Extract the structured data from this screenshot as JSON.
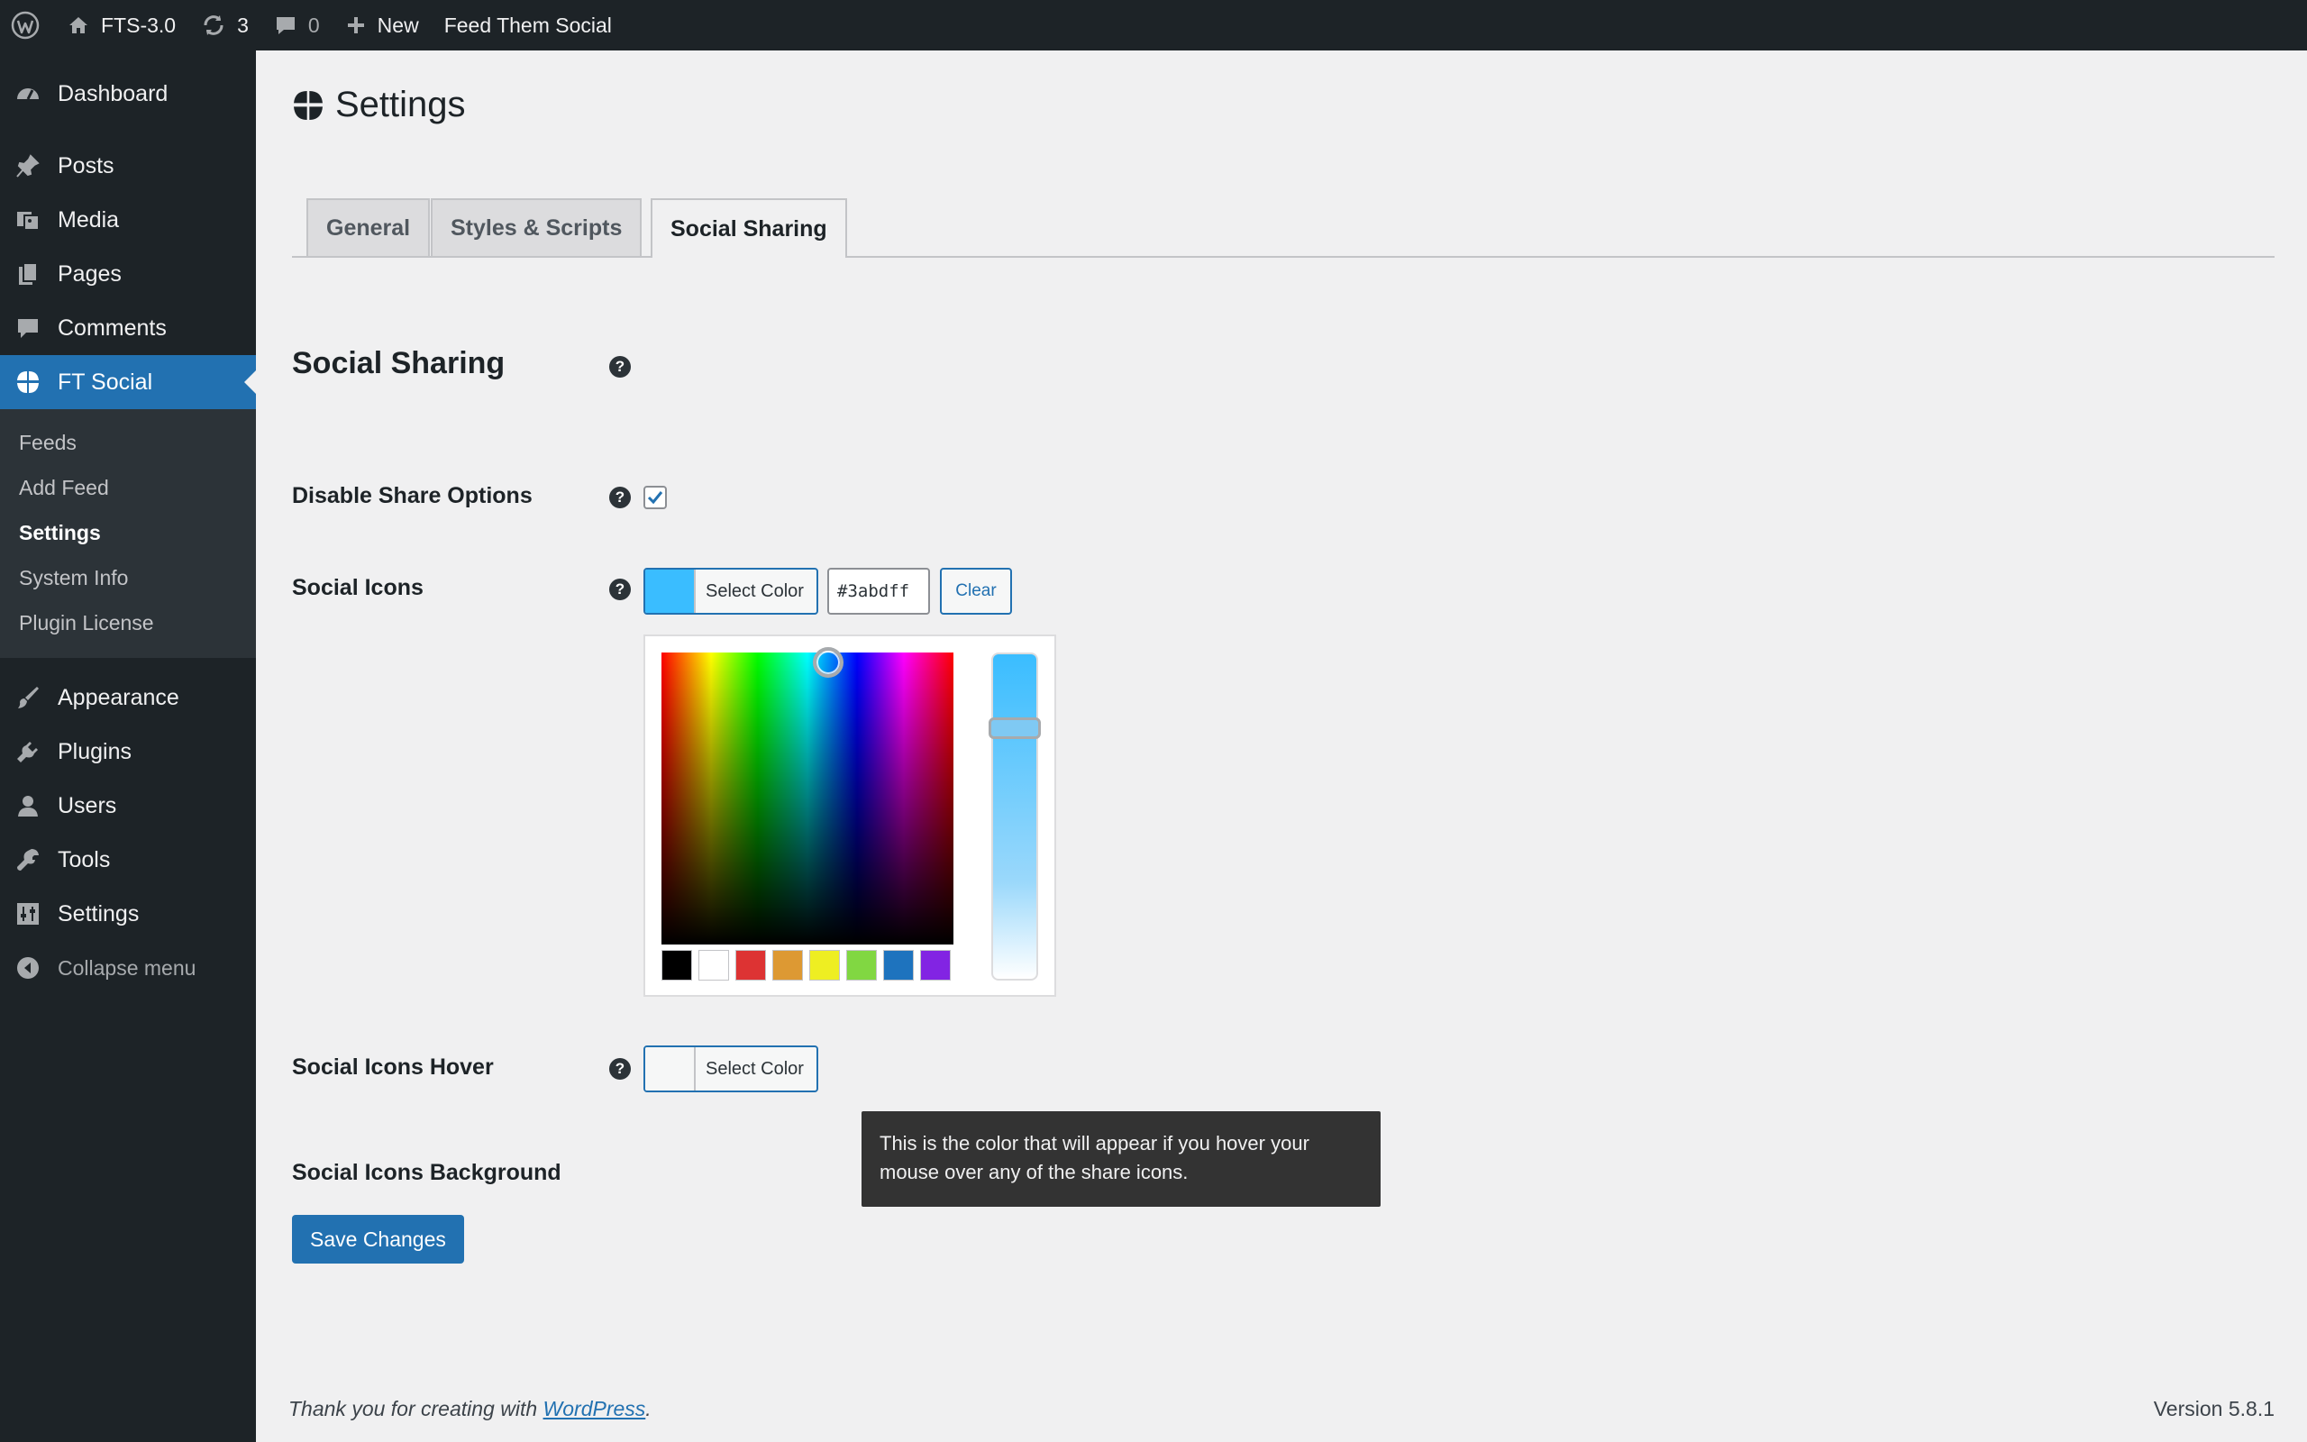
{
  "adminbar": {
    "site_name": "FTS-3.0",
    "updates_count": "3",
    "comments_count": "0",
    "new_label": "New",
    "plugin_label": "Feed Them Social"
  },
  "sidebar": {
    "items": [
      {
        "label": "Dashboard",
        "icon": "dashboard-icon"
      },
      {
        "label": "Posts",
        "icon": "pin-icon"
      },
      {
        "label": "Media",
        "icon": "media-icon"
      },
      {
        "label": "Pages",
        "icon": "pages-icon"
      },
      {
        "label": "Comments",
        "icon": "comment-icon"
      },
      {
        "label": "FT Social",
        "icon": "ft-social-icon"
      }
    ],
    "submenu": [
      "Feeds",
      "Add Feed",
      "Settings",
      "System Info",
      "Plugin License"
    ],
    "items_after": [
      {
        "label": "Appearance",
        "icon": "brush-icon"
      },
      {
        "label": "Plugins",
        "icon": "plugin-icon"
      },
      {
        "label": "Users",
        "icon": "user-icon"
      },
      {
        "label": "Tools",
        "icon": "wrench-icon"
      },
      {
        "label": "Settings",
        "icon": "settings-icon"
      }
    ],
    "collapse_label": "Collapse menu"
  },
  "page": {
    "title": "Settings",
    "tabs": [
      "General",
      "Styles & Scripts",
      "Social Sharing"
    ],
    "active_tab": "Social Sharing"
  },
  "form": {
    "section_title": "Social Sharing",
    "disable_share_label": "Disable Share Options",
    "social_icons_label": "Social Icons",
    "select_color_label": "Select Color",
    "color_value": "#3abdff",
    "clear_label": "Clear",
    "social_icons_hover_label": "Social Icons Hover",
    "hover_select_color_label": "Select Color",
    "social_icons_background_label": "Social Icons Background",
    "tooltip_text": "This is the color that will appear if you hover your mouse over any of the share icons.",
    "save_label": "Save Changes"
  },
  "palette": [
    "#000000",
    "#ffffff",
    "#dd3333",
    "#dd9933",
    "#eeee22",
    "#81d742",
    "#1e73be",
    "#8224e3"
  ],
  "colors": {
    "accent": "#2271b1",
    "sidebar_bg": "#1d2327",
    "selected_color": "#3abdff"
  },
  "footer": {
    "thanks_prefix": "Thank you for creating with ",
    "link_text": "WordPress",
    "suffix": ".",
    "version": "Version 5.8.1"
  }
}
